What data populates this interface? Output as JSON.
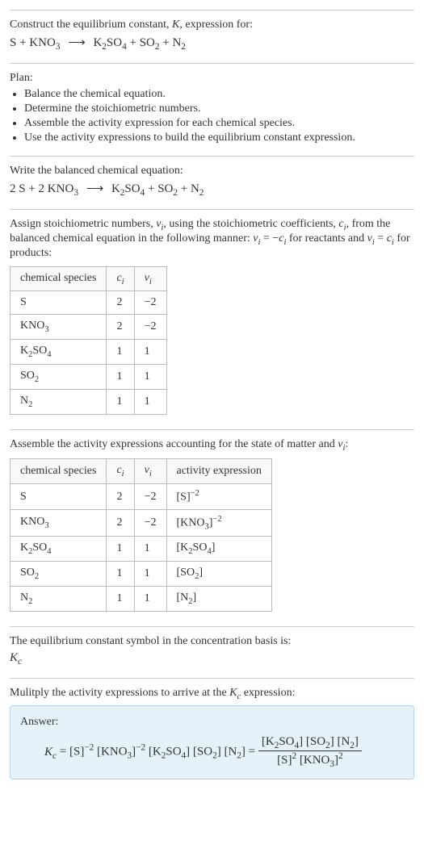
{
  "intro": {
    "line1": "Construct the equilibrium constant, K, expression for:",
    "equation": "S + KNO₃  ⟶  K₂SO₄ + SO₂ + N₂"
  },
  "plan": {
    "heading": "Plan:",
    "items": [
      "Balance the chemical equation.",
      "Determine the stoichiometric numbers.",
      "Assemble the activity expression for each chemical species.",
      "Use the activity expressions to build the equilibrium constant expression."
    ]
  },
  "balanced": {
    "heading": "Write the balanced chemical equation:",
    "equation": "2 S + 2 KNO₃  ⟶  K₂SO₄ + SO₂ + N₂"
  },
  "stoich": {
    "text1": "Assign stoichiometric numbers, νᵢ, using the stoichiometric coefficients, cᵢ, from the balanced chemical equation in the following manner: νᵢ = −cᵢ for reactants and νᵢ = cᵢ for products:",
    "headers": [
      "chemical species",
      "cᵢ",
      "νᵢ"
    ],
    "rows": [
      {
        "sp": "S",
        "c": "2",
        "v": "−2"
      },
      {
        "sp": "KNO₃",
        "c": "2",
        "v": "−2"
      },
      {
        "sp": "K₂SO₄",
        "c": "1",
        "v": "1"
      },
      {
        "sp": "SO₂",
        "c": "1",
        "v": "1"
      },
      {
        "sp": "N₂",
        "c": "1",
        "v": "1"
      }
    ]
  },
  "activity": {
    "text1": "Assemble the activity expressions accounting for the state of matter and νᵢ:",
    "headers": [
      "chemical species",
      "cᵢ",
      "νᵢ",
      "activity expression"
    ],
    "rows": [
      {
        "sp": "S",
        "c": "2",
        "v": "−2",
        "a": "[S]⁻²"
      },
      {
        "sp": "KNO₃",
        "c": "2",
        "v": "−2",
        "a": "[KNO₃]⁻²"
      },
      {
        "sp": "K₂SO₄",
        "c": "1",
        "v": "1",
        "a": "[K₂SO₄]"
      },
      {
        "sp": "SO₂",
        "c": "1",
        "v": "1",
        "a": "[SO₂]"
      },
      {
        "sp": "N₂",
        "c": "1",
        "v": "1",
        "a": "[N₂]"
      }
    ]
  },
  "symbol": {
    "text": "The equilibrium constant symbol in the concentration basis is:",
    "sym": "K꜀"
  },
  "final": {
    "text": "Mulitply the activity expressions to arrive at the K꜀ expression:",
    "answer_label": "Answer:",
    "lhs": "K꜀ = [S]⁻² [KNO₃]⁻² [K₂SO₄] [SO₂] [N₂] = ",
    "num": "[K₂SO₄] [SO₂] [N₂]",
    "den": "[S]² [KNO₃]²"
  },
  "chart_data": {
    "type": "table",
    "tables": [
      {
        "title": "Stoichiometric numbers",
        "columns": [
          "chemical species",
          "cᵢ",
          "νᵢ"
        ],
        "rows": [
          [
            "S",
            "2",
            "-2"
          ],
          [
            "KNO₃",
            "2",
            "-2"
          ],
          [
            "K₂SO₄",
            "1",
            "1"
          ],
          [
            "SO₂",
            "1",
            "1"
          ],
          [
            "N₂",
            "1",
            "1"
          ]
        ]
      },
      {
        "title": "Activity expressions",
        "columns": [
          "chemical species",
          "cᵢ",
          "νᵢ",
          "activity expression"
        ],
        "rows": [
          [
            "S",
            "2",
            "-2",
            "[S]^-2"
          ],
          [
            "KNO₃",
            "2",
            "-2",
            "[KNO₃]^-2"
          ],
          [
            "K₂SO₄",
            "1",
            "1",
            "[K₂SO₄]"
          ],
          [
            "SO₂",
            "1",
            "1",
            "[SO₂]"
          ],
          [
            "N₂",
            "1",
            "1",
            "[N₂]"
          ]
        ]
      }
    ]
  }
}
